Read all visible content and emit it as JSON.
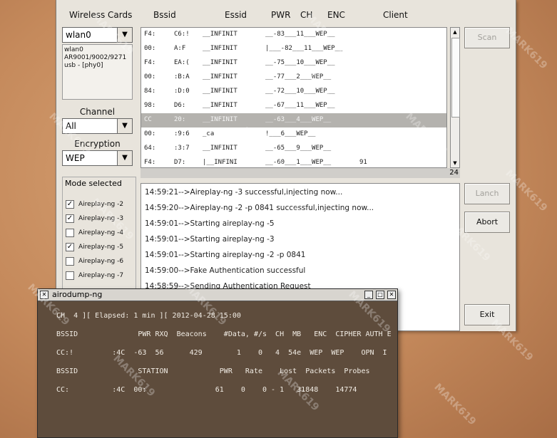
{
  "headers": {
    "wireless_cards": "Wireless Cards",
    "bssid": "Bssid",
    "essid": "Essid",
    "pwr": "PWR",
    "ch": "CH",
    "enc": "ENC",
    "client": "Client"
  },
  "card": {
    "selected": "wlan0",
    "info": "wlan0\nAR9001/9002/9271 usb - [phy0]"
  },
  "channel": {
    "label": "Channel",
    "value": "All"
  },
  "encryption": {
    "label": "Encryption",
    "value": "WEP"
  },
  "networks": [
    {
      "bssid": "F4:",
      "b2": "C6:!",
      "essid": "__INFINIT",
      "pwr": "__-83___11___WEP__"
    },
    {
      "bssid": "00:",
      "b2": "A:F",
      "essid": "__INFINIT",
      "pwr": "|___-82___11___WEP__"
    },
    {
      "bssid": "F4:",
      "b2": "EA:(",
      "essid": "__INFINIT",
      "pwr": "__-75___10___WEP__"
    },
    {
      "bssid": "00:",
      "b2": ":B:A",
      "essid": "__INFINIT",
      "pwr": "__-77___2___WEP__"
    },
    {
      "bssid": "84:",
      "b2": ":D:0",
      "essid": "__INFINIT",
      "pwr": "__-72___10___WEP__"
    },
    {
      "bssid": "98:",
      "b2": "D6:",
      "essid": "__INFINIT",
      "pwr": "__-67___11___WEP__"
    },
    {
      "bssid": "CC",
      "b2": "20:",
      "essid": "__INFINIT",
      "pwr": "__-63___4___WEP__"
    },
    {
      "bssid": "00:",
      "b2": ":9:6",
      "essid": "_ca",
      "pwr": "!___6___WEP__"
    },
    {
      "bssid": "64:",
      "b2": ":3:7",
      "essid": "__INFINIT",
      "pwr": "__-65___9___WEP__"
    },
    {
      "bssid": "F4:",
      "b2": "D7:",
      "essid": "|__INFINI",
      "pwr": "__-60___1___WEP__",
      "client": "91"
    }
  ],
  "network_count": "24",
  "buttons": {
    "scan": "Scan",
    "lanch": "Lanch",
    "abort": "Abort",
    "exit": "Exit"
  },
  "mode": {
    "title": "Mode selected",
    "items": [
      {
        "label": "Aireplay-ng -2",
        "checked": true
      },
      {
        "label": "Aireplay-ng -3",
        "checked": true
      },
      {
        "label": "Aireplay-ng -4",
        "checked": false
      },
      {
        "label": "Aireplay-ng -5",
        "checked": true
      },
      {
        "label": "Aireplay-ng -6",
        "checked": false
      },
      {
        "label": "Aireplay-ng -7",
        "checked": false
      }
    ]
  },
  "log": [
    "14:59:21-->Aireplay-ng -3 successful,injecting now...",
    "14:59:20-->Aireplay-ng -2 -p 0841 successful,injecting now...",
    "14:59:01-->Starting aireplay-ng -5",
    "14:59:01-->Starting aireplay-ng -3",
    "14:59:01-->Starting aireplay-ng -2 -p 0841",
    "14:59:00-->Fake Authentication successful",
    "14:58:59-->Sending Authentication Request"
  ],
  "terminal": {
    "title": "airodump-ng",
    "lines": [
      "CH  4 ][ Elapsed: 1 min ][ 2012-04-28 15:00",
      "BSSID              PWR RXQ  Beacons    #Data, #/s  CH  MB   ENC  CIPHER AUTH E",
      "CC:!         :4C  -63  56      429        1    0   4  54e  WEP  WEP    OPN  I",
      "BSSID              STATION            PWR   Rate    Lost  Packets  Probes",
      "CC:          :4C  00:                61    0    0 - 1   31848    14774"
    ]
  },
  "watermark": "MARK619"
}
